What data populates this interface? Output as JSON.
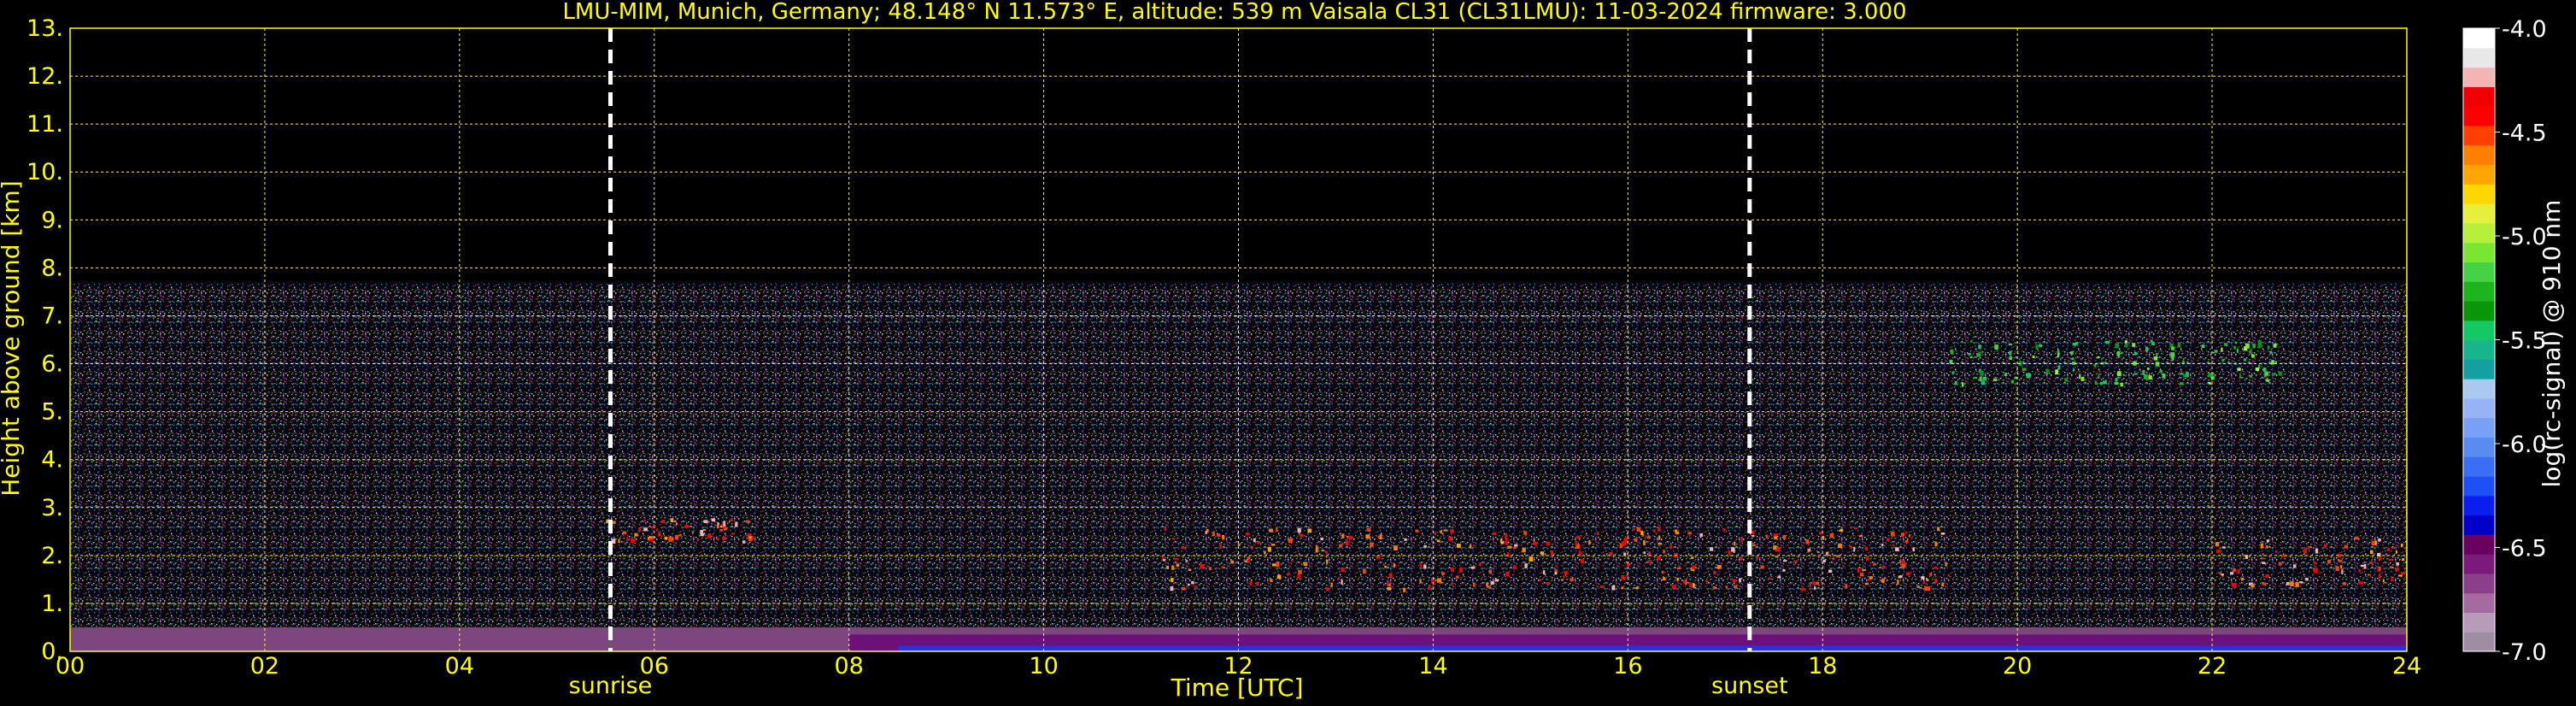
{
  "title": "LMU-MIM, Munich, Germany; 48.148° N 11.573° E, altitude: 539 m    Vaisala CL31 (CL31LMU): 11-03-2024    firmware: 3.000",
  "colors": {
    "axis_text": "#ffff00",
    "grid": "#ffff00",
    "background": "#000000",
    "markers": "#ffffff"
  },
  "chart_data": {
    "type": "heatmap",
    "title": "LMU-MIM, Munich, Germany; 48.148° N 11.573° E, altitude: 539 m    Vaisala CL31 (CL31LMU): 11-03-2024    firmware: 3.000",
    "xlabel": "Time [UTC]",
    "ylabel": "Height above ground [km]",
    "xlim": [
      0,
      24
    ],
    "ylim": [
      0,
      13
    ],
    "x_ticks": [
      0,
      2,
      4,
      6,
      8,
      10,
      12,
      14,
      16,
      18,
      20,
      22,
      24
    ],
    "x_tick_labels": [
      "00",
      "02",
      "04",
      "06",
      "08",
      "10",
      "12",
      "14",
      "16",
      "18",
      "20",
      "22",
      "24"
    ],
    "y_ticks": [
      0,
      1,
      2,
      3,
      4,
      5,
      6,
      7,
      8,
      9,
      10,
      11,
      12,
      13
    ],
    "y_tick_labels": [
      "0.",
      "1.",
      "2.",
      "3.",
      "4.",
      "5.",
      "6.",
      "7.",
      "8.",
      "9.",
      "10.",
      "11.",
      "12.",
      "13."
    ],
    "grid": true,
    "markers": [
      {
        "label": "sunrise",
        "time": 5.55
      },
      {
        "label": "sunset",
        "time": 17.25
      }
    ],
    "colorbar": {
      "label": "log(rc-signal) @ 910 nm",
      "range": [
        -7.0,
        -4.0
      ],
      "ticks": [
        -4.0,
        -4.5,
        -5.0,
        -5.5,
        -6.0,
        -6.5,
        -7.0
      ],
      "tick_labels": [
        "-4.0",
        "-4.5",
        "-5.0",
        "-5.5",
        "-6.0",
        "-6.5",
        "-7.0"
      ],
      "colors": [
        "#9e8ea2",
        "#b69cb8",
        "#a56aa0",
        "#8a3f8a",
        "#7a1a7a",
        "#6a005f",
        "#0000c8",
        "#0a1ef0",
        "#1e50f5",
        "#3c6ef5",
        "#5a8cf0",
        "#78a0f5",
        "#96b4f5",
        "#aac8f0",
        "#14a0a0",
        "#18b48c",
        "#14c864",
        "#0a960a",
        "#1eb41e",
        "#46d246",
        "#78e632",
        "#b4f03c",
        "#e6f03c",
        "#ffd700",
        "#ffa500",
        "#ff8000",
        "#ff4000",
        "#ff0000",
        "#f00000",
        "#f5b4b4",
        "#e8e8e8",
        "#ffffff"
      ]
    },
    "signal_regions": [
      {
        "name": "surface-aerosol",
        "x": [
          0,
          24
        ],
        "y": [
          0,
          0.5
        ],
        "level": -6.7
      },
      {
        "name": "noise-field",
        "x": [
          0,
          24
        ],
        "y": [
          0.5,
          7.7
        ],
        "level": -6.3
      },
      {
        "name": "early-cloud",
        "x": [
          5.5,
          7.0
        ],
        "y": [
          2.3,
          2.8
        ],
        "level": -4.2
      },
      {
        "name": "boundary-layer-clouds",
        "x": [
          11.2,
          19.3
        ],
        "y": [
          1.3,
          2.6
        ],
        "level": -4.2
      },
      {
        "name": "high-cloud",
        "x": [
          19.3,
          22.7
        ],
        "y": [
          5.6,
          6.5
        ],
        "level": -5.0
      },
      {
        "name": "late-clouds",
        "x": [
          22.0,
          24.0
        ],
        "y": [
          1.4,
          2.4
        ],
        "level": -4.2
      }
    ]
  }
}
